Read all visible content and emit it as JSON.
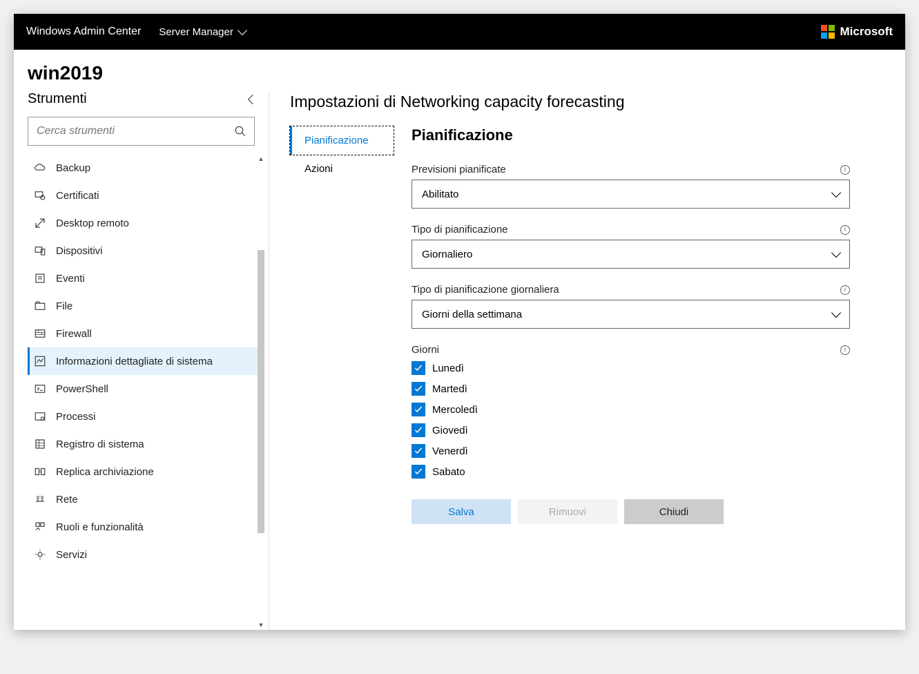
{
  "topbar": {
    "title": "Windows Admin Center",
    "dropdown": "Server Manager",
    "brand": "Microsoft"
  },
  "server_name": "win2019",
  "sidebar": {
    "title": "Strumenti",
    "search_placeholder": "Cerca strumenti",
    "items": [
      {
        "label": "Backup",
        "icon": "cloud"
      },
      {
        "label": "Certificati",
        "icon": "cert"
      },
      {
        "label": "Desktop remoto",
        "icon": "remote"
      },
      {
        "label": "Dispositivi",
        "icon": "devices"
      },
      {
        "label": "Eventi",
        "icon": "events"
      },
      {
        "label": "File",
        "icon": "file"
      },
      {
        "label": "Firewall",
        "icon": "firewall"
      },
      {
        "label": "Informazioni dettagliate di sistema",
        "icon": "insights",
        "selected": true
      },
      {
        "label": "PowerShell",
        "icon": "shell"
      },
      {
        "label": "Processi",
        "icon": "process"
      },
      {
        "label": "Registro di sistema",
        "icon": "registry"
      },
      {
        "label": "Replica archiviazione",
        "icon": "replica"
      },
      {
        "label": "Rete",
        "icon": "network"
      },
      {
        "label": "Ruoli e funzionalità",
        "icon": "roles"
      },
      {
        "label": "Servizi",
        "icon": "services"
      }
    ]
  },
  "main": {
    "title": "Impostazioni di Networking capacity forecasting",
    "tabs": [
      {
        "label": "Pianificazione",
        "active": true
      },
      {
        "label": "Azioni"
      }
    ],
    "heading": "Pianificazione",
    "fields": {
      "scheduled_forecasts": {
        "label": "Previsioni pianificate",
        "value": "Abilitato"
      },
      "schedule_type": {
        "label": "Tipo di pianificazione",
        "value": "Giornaliero"
      },
      "daily_type": {
        "label": "Tipo di pianificazione giornaliera",
        "value": "Giorni della settimana"
      },
      "days": {
        "label": "Giorni",
        "options": [
          "Lunedì",
          "Martedì",
          "Mercoledì",
          "Giovedì",
          "Venerdì",
          "Sabato"
        ]
      }
    },
    "buttons": {
      "save": "Salva",
      "remove": "Rimuovi",
      "close": "Chiudi"
    }
  }
}
